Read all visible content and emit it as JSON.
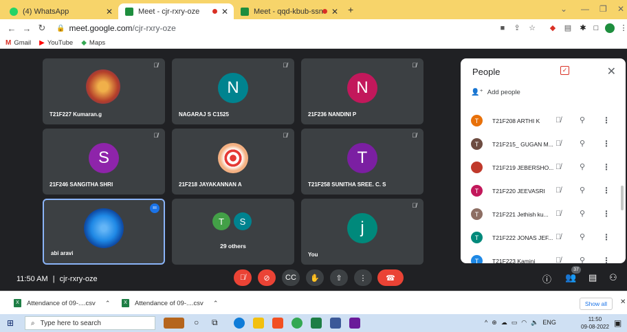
{
  "browser": {
    "tabs": [
      {
        "title": "(4) WhatsApp",
        "color": "#25d366",
        "active": false
      },
      {
        "title": "Meet - cjr-rxry-oze",
        "color": "#1e8e3e",
        "active": true
      },
      {
        "title": "Meet - qqd-kbub-ssn",
        "color": "#1e8e3e",
        "active": false
      }
    ],
    "new_tab": "+",
    "url_host": "meet.google.com",
    "url_path": "/cjr-rxry-oze",
    "bookmarks": [
      {
        "label": "Gmail",
        "icon": "M",
        "color": "#d93025"
      },
      {
        "label": "YouTube",
        "icon": "▶",
        "color": "#ff0000"
      },
      {
        "label": "Maps",
        "icon": "◆",
        "color": "#34a853"
      }
    ]
  },
  "tiles": [
    {
      "name": "T21F227 Kumaran.g",
      "initial": "",
      "avatar_color": "#c55a2a",
      "muted": true
    },
    {
      "name": "NAGARAJ S C1525",
      "initial": "N",
      "avatar_color": "#00838f",
      "muted": true
    },
    {
      "name": "21F236 NANDINI P",
      "initial": "N",
      "avatar_color": "#c2185b",
      "muted": true
    },
    {
      "name": "21F246 SANGITHA SHRI",
      "initial": "S",
      "avatar_color": "#8e24aa",
      "muted": true
    },
    {
      "name": "21F218 JAYAKANNAN A",
      "initial": "",
      "avatar_color": "#f48fb1",
      "muted": true
    },
    {
      "name": "T21F258 SUNITHA SREE. C. S",
      "initial": "T",
      "avatar_color": "#7b1fa2",
      "muted": true
    },
    {
      "name": "abi aravi",
      "initial": "",
      "avatar_color": "#1e88e5",
      "muted": false
    },
    {
      "name": "29 others",
      "initial": "",
      "avatar_color": "",
      "muted": false
    },
    {
      "name": "You",
      "initial": "j",
      "avatar_color": "#00897b",
      "muted": true
    }
  ],
  "others_avatars": [
    {
      "initial": "T",
      "color": "#43a047"
    },
    {
      "initial": "S",
      "color": "#00838f"
    }
  ],
  "people_panel": {
    "title": "People",
    "add_people": "Add people",
    "close": "✕",
    "rows": [
      {
        "name": "T21F208 ARTHI K",
        "initial": "T",
        "color": "#e8710a"
      },
      {
        "name": "T21F215_ GUGAN M...",
        "initial": "T",
        "color": "#6d4c41"
      },
      {
        "name": "T21F219 JEBERSHO...",
        "initial": "",
        "color": "#c0392b"
      },
      {
        "name": "T21F220 JEEVASRI",
        "initial": "T",
        "color": "#c2185b"
      },
      {
        "name": "T21F221 Jethish ku...",
        "initial": "T",
        "color": "#8d6e63"
      },
      {
        "name": "T21F222 JONAS JEF...",
        "initial": "T",
        "color": "#00897b"
      },
      {
        "name": "T21F223 Kamini",
        "initial": "T",
        "color": "#1e88e5"
      }
    ]
  },
  "meeting": {
    "time": "11:50 AM",
    "separator": "|",
    "code": "cjr-rxry-oze",
    "participant_count": "37"
  },
  "downloads": [
    {
      "name": "Attendance of 09-....csv"
    },
    {
      "name": "Attendance of 09-....csv"
    }
  ],
  "show_all": "Show all",
  "taskbar": {
    "search_placeholder": "Type here to search",
    "lang": "ENG",
    "time": "11:50",
    "date": "09-08-2022"
  }
}
